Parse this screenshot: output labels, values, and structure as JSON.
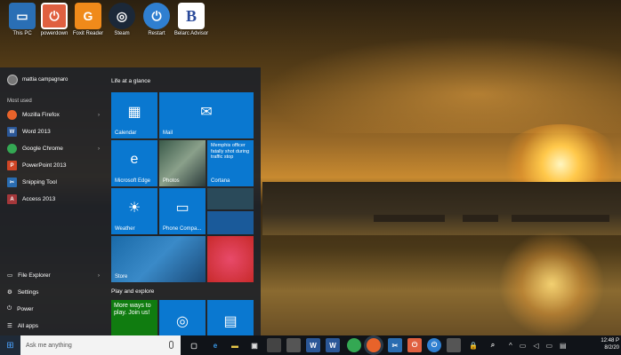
{
  "desktop": {
    "icons": [
      {
        "label": "This PC",
        "icon": "computer-icon"
      },
      {
        "label": "powerdown",
        "icon": "power-app-icon"
      },
      {
        "label": "Foxit Reader",
        "icon": "pdf-icon"
      },
      {
        "label": "Steam",
        "icon": "steam-icon"
      },
      {
        "label": "Restart",
        "icon": "restart-icon"
      },
      {
        "label": "Belarc Advisor",
        "icon": "belarc-icon"
      }
    ]
  },
  "start": {
    "user": "mattia campagnaro",
    "most_used_label": "Most used",
    "apps": [
      {
        "label": "Mozilla Firefox",
        "color": "#e8632a",
        "glyph": "●",
        "chevron": "›"
      },
      {
        "label": "Word 2013",
        "color": "#2b5797",
        "glyph": "W",
        "chevron": ""
      },
      {
        "label": "Google Chrome",
        "color": "#34a853",
        "glyph": "◉",
        "chevron": "›"
      },
      {
        "label": "PowerPoint 2013",
        "color": "#d04525",
        "glyph": "P",
        "chevron": ""
      },
      {
        "label": "Snipping Tool",
        "color": "#2a6cb0",
        "glyph": "✂",
        "chevron": ""
      },
      {
        "label": "Access 2013",
        "color": "#a4373a",
        "glyph": "A",
        "chevron": ""
      }
    ],
    "system": [
      {
        "label": "File Explorer",
        "glyph": "▭",
        "chevron": "›"
      },
      {
        "label": "Settings",
        "glyph": "⚙",
        "chevron": ""
      },
      {
        "label": "Power",
        "glyph": "⏻",
        "chevron": ""
      },
      {
        "label": "All apps",
        "glyph": "☰",
        "chevron": ""
      }
    ],
    "life_label": "Life at a glance",
    "play_label": "Play and explore",
    "tiles": {
      "calendar": "Calendar",
      "mail": "Mail",
      "edge": "Microsoft Edge",
      "photos": "Photos",
      "cortana_news": "Memphis officer fatally shot during traffic stop",
      "cortana": "Cortana",
      "weather": "Weather",
      "phone": "Phone Compa...",
      "store": "Store",
      "xbox": "More ways to play. Join us!"
    }
  },
  "taskbar": {
    "search_placeholder": "Ask me anything",
    "time": "12:48 P",
    "date": "8/2/20"
  }
}
